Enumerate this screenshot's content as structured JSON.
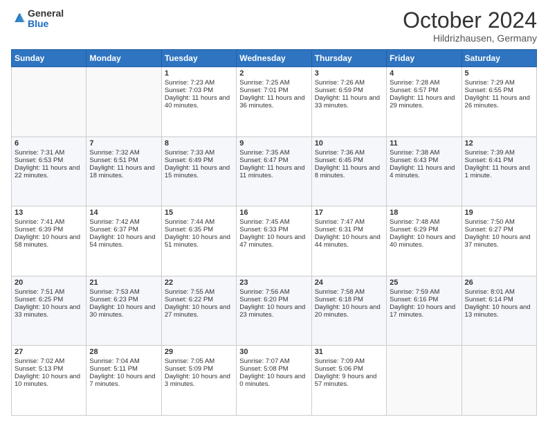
{
  "logo": {
    "general": "General",
    "blue": "Blue"
  },
  "header": {
    "title": "October 2024",
    "subtitle": "Hildrizhausen, Germany"
  },
  "days_of_week": [
    "Sunday",
    "Monday",
    "Tuesday",
    "Wednesday",
    "Thursday",
    "Friday",
    "Saturday"
  ],
  "weeks": [
    [
      {
        "day": "",
        "sunrise": "",
        "sunset": "",
        "daylight": ""
      },
      {
        "day": "",
        "sunrise": "",
        "sunset": "",
        "daylight": ""
      },
      {
        "day": "1",
        "sunrise": "Sunrise: 7:23 AM",
        "sunset": "Sunset: 7:03 PM",
        "daylight": "Daylight: 11 hours and 40 minutes."
      },
      {
        "day": "2",
        "sunrise": "Sunrise: 7:25 AM",
        "sunset": "Sunset: 7:01 PM",
        "daylight": "Daylight: 11 hours and 36 minutes."
      },
      {
        "day": "3",
        "sunrise": "Sunrise: 7:26 AM",
        "sunset": "Sunset: 6:59 PM",
        "daylight": "Daylight: 11 hours and 33 minutes."
      },
      {
        "day": "4",
        "sunrise": "Sunrise: 7:28 AM",
        "sunset": "Sunset: 6:57 PM",
        "daylight": "Daylight: 11 hours and 29 minutes."
      },
      {
        "day": "5",
        "sunrise": "Sunrise: 7:29 AM",
        "sunset": "Sunset: 6:55 PM",
        "daylight": "Daylight: 11 hours and 26 minutes."
      }
    ],
    [
      {
        "day": "6",
        "sunrise": "Sunrise: 7:31 AM",
        "sunset": "Sunset: 6:53 PM",
        "daylight": "Daylight: 11 hours and 22 minutes."
      },
      {
        "day": "7",
        "sunrise": "Sunrise: 7:32 AM",
        "sunset": "Sunset: 6:51 PM",
        "daylight": "Daylight: 11 hours and 18 minutes."
      },
      {
        "day": "8",
        "sunrise": "Sunrise: 7:33 AM",
        "sunset": "Sunset: 6:49 PM",
        "daylight": "Daylight: 11 hours and 15 minutes."
      },
      {
        "day": "9",
        "sunrise": "Sunrise: 7:35 AM",
        "sunset": "Sunset: 6:47 PM",
        "daylight": "Daylight: 11 hours and 11 minutes."
      },
      {
        "day": "10",
        "sunrise": "Sunrise: 7:36 AM",
        "sunset": "Sunset: 6:45 PM",
        "daylight": "Daylight: 11 hours and 8 minutes."
      },
      {
        "day": "11",
        "sunrise": "Sunrise: 7:38 AM",
        "sunset": "Sunset: 6:43 PM",
        "daylight": "Daylight: 11 hours and 4 minutes."
      },
      {
        "day": "12",
        "sunrise": "Sunrise: 7:39 AM",
        "sunset": "Sunset: 6:41 PM",
        "daylight": "Daylight: 11 hours and 1 minute."
      }
    ],
    [
      {
        "day": "13",
        "sunrise": "Sunrise: 7:41 AM",
        "sunset": "Sunset: 6:39 PM",
        "daylight": "Daylight: 10 hours and 58 minutes."
      },
      {
        "day": "14",
        "sunrise": "Sunrise: 7:42 AM",
        "sunset": "Sunset: 6:37 PM",
        "daylight": "Daylight: 10 hours and 54 minutes."
      },
      {
        "day": "15",
        "sunrise": "Sunrise: 7:44 AM",
        "sunset": "Sunset: 6:35 PM",
        "daylight": "Daylight: 10 hours and 51 minutes."
      },
      {
        "day": "16",
        "sunrise": "Sunrise: 7:45 AM",
        "sunset": "Sunset: 6:33 PM",
        "daylight": "Daylight: 10 hours and 47 minutes."
      },
      {
        "day": "17",
        "sunrise": "Sunrise: 7:47 AM",
        "sunset": "Sunset: 6:31 PM",
        "daylight": "Daylight: 10 hours and 44 minutes."
      },
      {
        "day": "18",
        "sunrise": "Sunrise: 7:48 AM",
        "sunset": "Sunset: 6:29 PM",
        "daylight": "Daylight: 10 hours and 40 minutes."
      },
      {
        "day": "19",
        "sunrise": "Sunrise: 7:50 AM",
        "sunset": "Sunset: 6:27 PM",
        "daylight": "Daylight: 10 hours and 37 minutes."
      }
    ],
    [
      {
        "day": "20",
        "sunrise": "Sunrise: 7:51 AM",
        "sunset": "Sunset: 6:25 PM",
        "daylight": "Daylight: 10 hours and 33 minutes."
      },
      {
        "day": "21",
        "sunrise": "Sunrise: 7:53 AM",
        "sunset": "Sunset: 6:23 PM",
        "daylight": "Daylight: 10 hours and 30 minutes."
      },
      {
        "day": "22",
        "sunrise": "Sunrise: 7:55 AM",
        "sunset": "Sunset: 6:22 PM",
        "daylight": "Daylight: 10 hours and 27 minutes."
      },
      {
        "day": "23",
        "sunrise": "Sunrise: 7:56 AM",
        "sunset": "Sunset: 6:20 PM",
        "daylight": "Daylight: 10 hours and 23 minutes."
      },
      {
        "day": "24",
        "sunrise": "Sunrise: 7:58 AM",
        "sunset": "Sunset: 6:18 PM",
        "daylight": "Daylight: 10 hours and 20 minutes."
      },
      {
        "day": "25",
        "sunrise": "Sunrise: 7:59 AM",
        "sunset": "Sunset: 6:16 PM",
        "daylight": "Daylight: 10 hours and 17 minutes."
      },
      {
        "day": "26",
        "sunrise": "Sunrise: 8:01 AM",
        "sunset": "Sunset: 6:14 PM",
        "daylight": "Daylight: 10 hours and 13 minutes."
      }
    ],
    [
      {
        "day": "27",
        "sunrise": "Sunrise: 7:02 AM",
        "sunset": "Sunset: 5:13 PM",
        "daylight": "Daylight: 10 hours and 10 minutes."
      },
      {
        "day": "28",
        "sunrise": "Sunrise: 7:04 AM",
        "sunset": "Sunset: 5:11 PM",
        "daylight": "Daylight: 10 hours and 7 minutes."
      },
      {
        "day": "29",
        "sunrise": "Sunrise: 7:05 AM",
        "sunset": "Sunset: 5:09 PM",
        "daylight": "Daylight: 10 hours and 3 minutes."
      },
      {
        "day": "30",
        "sunrise": "Sunrise: 7:07 AM",
        "sunset": "Sunset: 5:08 PM",
        "daylight": "Daylight: 10 hours and 0 minutes."
      },
      {
        "day": "31",
        "sunrise": "Sunrise: 7:09 AM",
        "sunset": "Sunset: 5:06 PM",
        "daylight": "Daylight: 9 hours and 57 minutes."
      },
      {
        "day": "",
        "sunrise": "",
        "sunset": "",
        "daylight": ""
      },
      {
        "day": "",
        "sunrise": "",
        "sunset": "",
        "daylight": ""
      }
    ]
  ]
}
